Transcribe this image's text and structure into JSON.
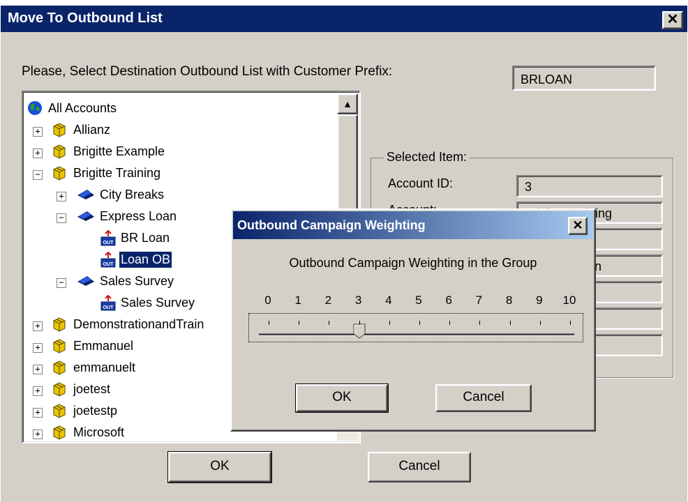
{
  "window": {
    "title": "Move To Outbound List",
    "close_glyph": "✕"
  },
  "prompt": "Please, Select Destination Outbound List with Customer Prefix:",
  "customer_prefix": "BRLOAN",
  "tree": {
    "nodes": [
      {
        "label": "All Accounts",
        "icon": "globe-icon"
      },
      {
        "label": "Allianz",
        "icon": "account-box-icon",
        "expander": "+"
      },
      {
        "label": "Brigitte Example",
        "icon": "account-box-icon",
        "expander": "+"
      },
      {
        "label": "Brigitte Training",
        "icon": "account-box-icon",
        "expander": "−"
      },
      {
        "label": "City Breaks",
        "icon": "campaign-icon",
        "expander": "+"
      },
      {
        "label": "Express Loan",
        "icon": "campaign-icon",
        "expander": "−"
      },
      {
        "label": "BR Loan",
        "icon": "outbound-list-icon"
      },
      {
        "label": "Loan OB",
        "icon": "outbound-list-icon",
        "selected": true
      },
      {
        "label": "Sales Survey",
        "icon": "campaign-icon",
        "expander": "−"
      },
      {
        "label": "Sales Survey",
        "icon": "outbound-list-icon"
      },
      {
        "label": "DemonstrationandTrain",
        "icon": "account-box-icon",
        "expander": "+"
      },
      {
        "label": "Emmanuel",
        "icon": "account-box-icon",
        "expander": "+"
      },
      {
        "label": "emmanuelt",
        "icon": "account-box-icon",
        "expander": "+"
      },
      {
        "label": "joetest",
        "icon": "account-box-icon",
        "expander": "+"
      },
      {
        "label": "joetestp",
        "icon": "account-box-icon",
        "expander": "+"
      },
      {
        "label": "Microsoft",
        "icon": "account-box-icon",
        "expander": "+"
      }
    ],
    "outbound_badge": "OUT"
  },
  "selected_item": {
    "legend": "Selected Item:",
    "fields": [
      {
        "label": "Account ID:",
        "value": "3"
      },
      {
        "label": "Account:",
        "value": "Brigitte Training"
      },
      {
        "label": "",
        "value": ""
      },
      {
        "label": "",
        "value": "Express Loan"
      },
      {
        "label": "",
        "value": ""
      },
      {
        "label": "",
        "value": ""
      },
      {
        "label": "",
        "value": ""
      }
    ]
  },
  "buttons": {
    "ok": "OK",
    "cancel": "Cancel"
  },
  "dialog": {
    "title": "Outbound Campaign Weighting",
    "close_glyph": "✕",
    "prompt": "Outbound Campaign Weighting in the Group",
    "slider": {
      "min": 0,
      "max": 10,
      "value": 3,
      "tick_labels": [
        "0",
        "1",
        "2",
        "3",
        "4",
        "5",
        "6",
        "7",
        "8",
        "9",
        "10"
      ]
    },
    "ok": "OK",
    "cancel": "Cancel"
  }
}
